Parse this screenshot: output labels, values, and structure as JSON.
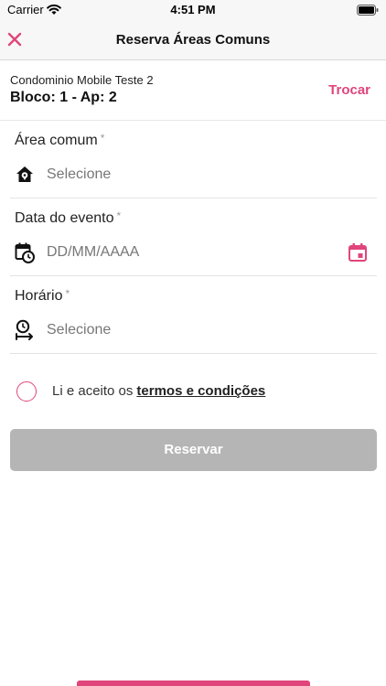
{
  "status_bar": {
    "carrier": "Carrier",
    "time": "4:51 PM"
  },
  "nav": {
    "title": "Reserva Áreas Comuns"
  },
  "condo": {
    "name": "Condominio Mobile Teste 2",
    "unit": "Bloco: 1 - Ap: 2",
    "switch_label": "Trocar"
  },
  "fields": {
    "area": {
      "label": "Área comum",
      "required_mark": "*",
      "placeholder": "Selecione",
      "icon": "home-pin-icon"
    },
    "date": {
      "label": "Data do evento",
      "required_mark": "*",
      "placeholder": "DD/MM/AAAA",
      "icon": "calendar-clock-icon",
      "action_icon": "calendar-icon"
    },
    "time": {
      "label": "Horário",
      "required_mark": "*",
      "placeholder": "Selecione",
      "icon": "clock-range-icon"
    }
  },
  "terms": {
    "prefix": "Li e aceito os",
    "link": "termos e condições",
    "accepted": false
  },
  "reserve_button": {
    "label": "Reservar",
    "enabled": false
  },
  "colors": {
    "accent": "#e0457b",
    "disabled": "#b5b5b5",
    "bar_bg": "#f7f7f7"
  }
}
